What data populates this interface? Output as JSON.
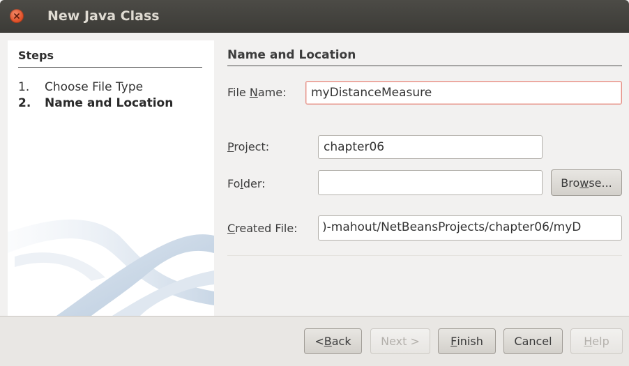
{
  "window": {
    "title": "New Java Class"
  },
  "steps": {
    "heading": "Steps",
    "items": [
      {
        "num": "1.",
        "label": "Choose File Type"
      },
      {
        "num": "2.",
        "label": "Name and Location"
      }
    ]
  },
  "main": {
    "section_title": "Name and Location",
    "file_name": {
      "label_pre": "File ",
      "label_mnemonic": "N",
      "label_post": "ame:",
      "value": "myDistanceMeasure"
    },
    "project": {
      "label_pre": "",
      "label_mnemonic": "P",
      "label_post": "roject:",
      "value": "chapter06"
    },
    "folder": {
      "label_pre": "Fo",
      "label_mnemonic": "l",
      "label_post": "der:",
      "value": ""
    },
    "browse": {
      "pre": "Bro",
      "mnemonic": "w",
      "post": "se..."
    },
    "created_file": {
      "label_pre": "",
      "label_mnemonic": "C",
      "label_post": "reated File:",
      "value": ")-mahout/NetBeansProjects/chapter06/myD"
    }
  },
  "buttons": {
    "back": {
      "pre": "< ",
      "mnemonic": "B",
      "post": "ack"
    },
    "next": {
      "pre": "Next >",
      "mnemonic": "",
      "post": ""
    },
    "finish": {
      "pre": "",
      "mnemonic": "F",
      "post": "inish"
    },
    "cancel": {
      "pre": "Cancel",
      "mnemonic": "",
      "post": ""
    },
    "help": {
      "pre": "",
      "mnemonic": "H",
      "post": "elp"
    }
  },
  "colors": {
    "titlebar": "#3c3b37",
    "close_button": "#e0522a",
    "focus_border": "#e58f86"
  }
}
